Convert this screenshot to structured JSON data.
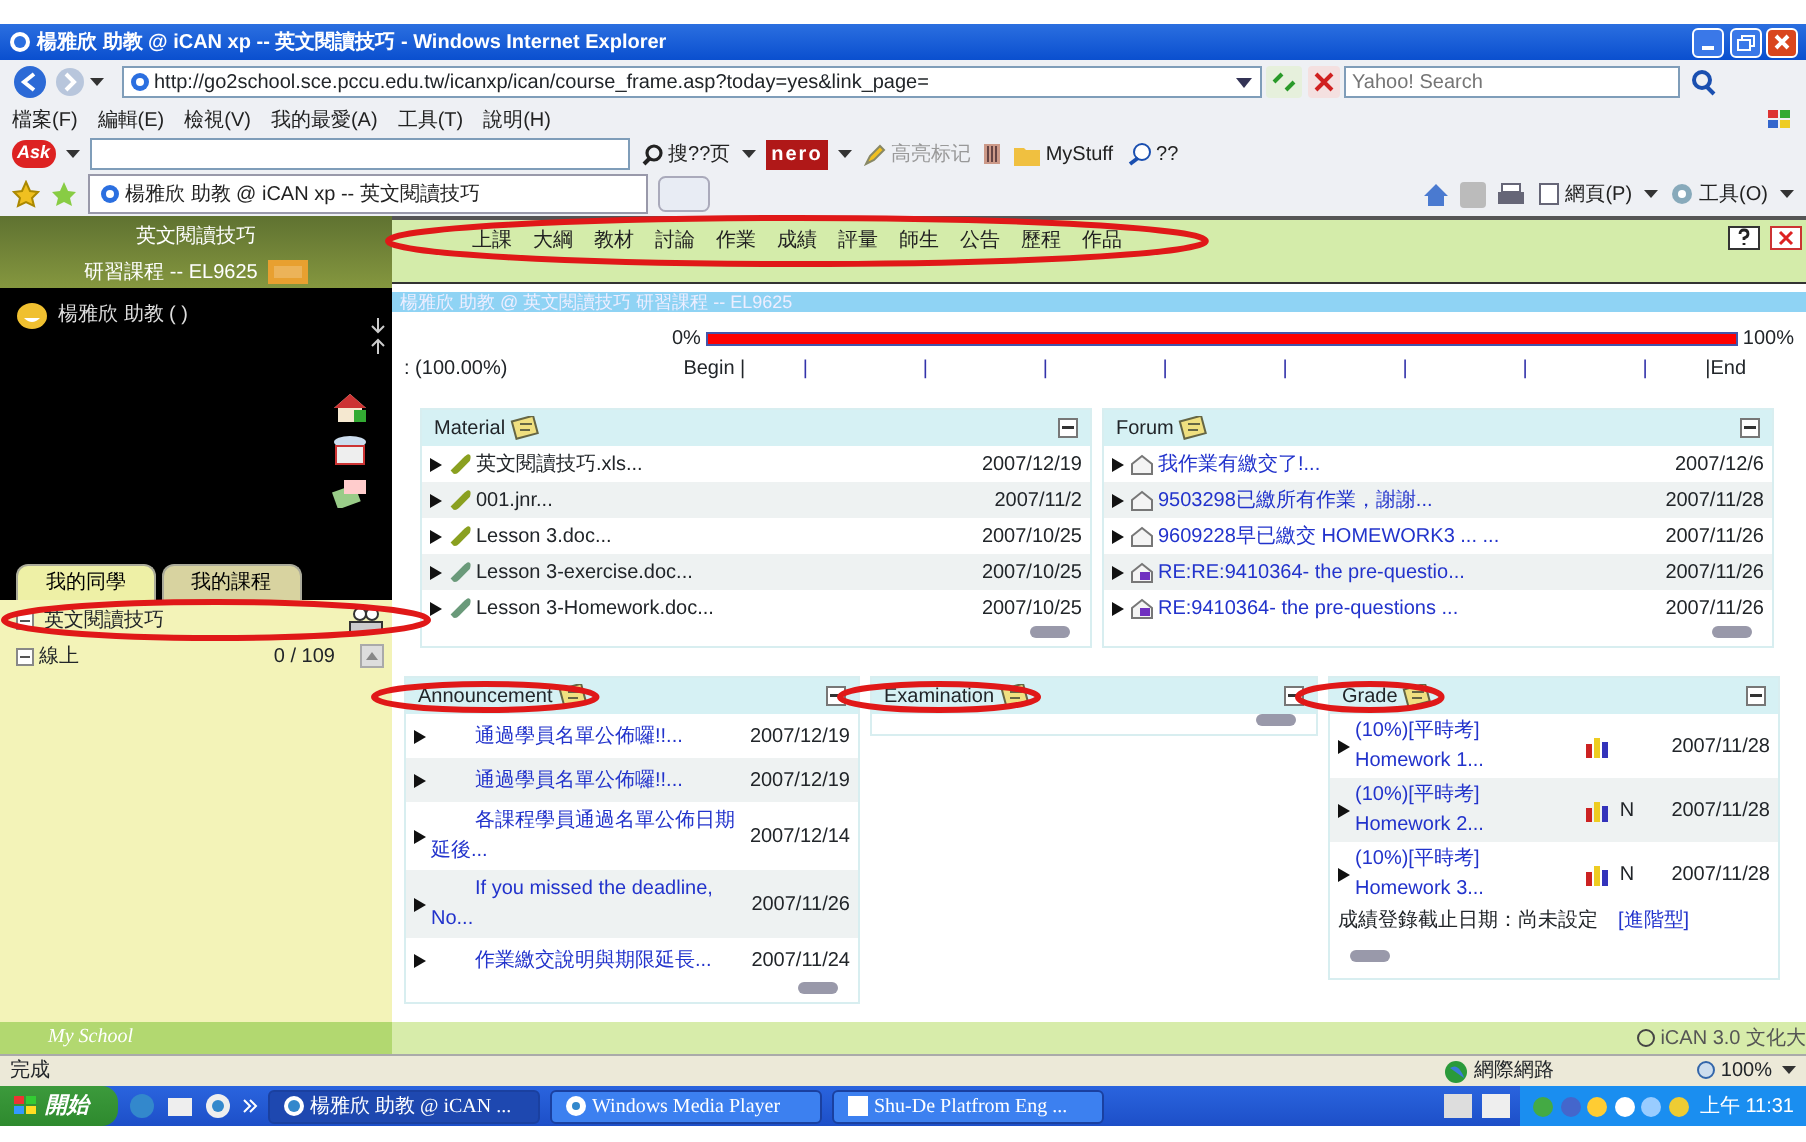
{
  "window": {
    "title": "楊雅欣 助教 @ iCAN xp -- 英文閱讀技巧 - Windows Internet Explorer"
  },
  "address_bar": {
    "url": "http://go2school.sce.pccu.edu.tw/icanxp/ican/course_frame.asp?today=yes&link_page=",
    "search_placeholder": "Yahoo! Search"
  },
  "menu_bar": [
    "檔案(F)",
    "編輯(E)",
    "檢視(V)",
    "我的最愛(A)",
    "工具(T)",
    "說明(H)"
  ],
  "ask_toolbar": {
    "logo": "Ask",
    "search_button": "搜??页",
    "nero_logo": "nero",
    "highlight_button": "高亮标记",
    "mystuff_button": "MyStuff",
    "zoom_button": "??"
  },
  "browser_tabs": [
    {
      "label": "楊雅欣 助教 @ iCAN xp -- 英文閱讀技巧",
      "selected": true
    }
  ],
  "command_bar": [
    "網頁(P)",
    "工具(O)"
  ],
  "sidebar": {
    "course": "英文閱讀技巧",
    "code": "研習課程 -- EL9625",
    "user": "楊雅欣 助教 ( )",
    "tabs": [
      {
        "label": "我的同學",
        "selected": true
      },
      {
        "label": "我的課程",
        "selected": false
      }
    ],
    "tree": {
      "label": "英文閱讀技巧",
      "expanded": true,
      "circled": true,
      "children": [
        {
          "label": "線上",
          "count": "0 / 109",
          "expanded": true
        }
      ]
    },
    "footer": "My School"
  },
  "course_menu": {
    "circled": true,
    "items": [
      "上課",
      "大綱",
      "教材",
      "討論",
      "作業",
      "成績",
      "評量",
      "師生",
      "公告",
      "歷程",
      "作品"
    ]
  },
  "breadcrumb": "楊雅欣 助教 @ 英文閱讀技巧 研習課程 -- EL9625",
  "progress": {
    "start_label": "0%",
    "end_label": "100%",
    "level": 1.0,
    "reading": ": (100.00%)",
    "begin": "Begin |",
    "ticks": [
      "|",
      "|",
      "|",
      "|",
      "|",
      "|",
      "|",
      "|"
    ],
    "end": "|End"
  },
  "panels": [
    {
      "kind": "material",
      "title": "Material",
      "circled": false,
      "items": [
        {
          "title": "英文閱讀技巧.xls...",
          "date": "2007/12/19",
          "kind": "new"
        },
        {
          "title": "001.jnr...",
          "date": "2007/11/2",
          "kind": "new"
        },
        {
          "title": "Lesson 3.doc...",
          "date": "2007/10/25",
          "kind": "new"
        },
        {
          "title": "Lesson 3-exercise.doc...",
          "date": "2007/10/25",
          "kind": "old"
        },
        {
          "title": "Lesson 3-Homework.doc...",
          "date": "2007/10/25",
          "kind": "old"
        }
      ]
    },
    {
      "kind": "forum",
      "title": "Forum",
      "circled": false,
      "items": [
        {
          "title": "我作業有繳交了!...",
          "date": "2007/12/6",
          "kind": "post"
        },
        {
          "title": "9503298已繳所有作業，謝謝...",
          "date": "2007/11/28",
          "kind": "post"
        },
        {
          "title": "9609228早已繳交 HOMEWORK3 ... ...",
          "date": "2007/11/26",
          "kind": "post"
        },
        {
          "title": "RE:RE:9410364- the pre-questio...",
          "date": "2007/11/26",
          "kind": "reply"
        },
        {
          "title": "RE:9410364- the pre-questions ...",
          "date": "2007/11/26",
          "kind": "reply"
        }
      ]
    },
    {
      "kind": "announcement",
      "title": "Announcement",
      "circled": true,
      "items": [
        {
          "title": "通過學員名單公佈囉!!...",
          "date": "2007/12/19"
        },
        {
          "title": "通過學員名單公佈囉!!...",
          "date": "2007/12/19"
        },
        {
          "title": "各課程學員通過名單公佈日期延後...",
          "date": "2007/12/14"
        },
        {
          "title": "If you missed the deadline, No...",
          "date": "2007/11/26"
        },
        {
          "title": "作業繳交說明與期限延長...",
          "date": "2007/11/24"
        }
      ]
    },
    {
      "kind": "examination",
      "title": "Examination",
      "circled": true
    },
    {
      "kind": "grade",
      "title": "Grade",
      "circled": true,
      "items": [
        {
          "title": "(10%)[平時考] Homework 1...",
          "date": "2007/11/28"
        },
        {
          "title": "(10%)[平時考] Homework 2...",
          "tag": "N",
          "date": "2007/11/28"
        },
        {
          "title": "(10%)[平時考] Homework 3...",
          "tag": "N",
          "date": "2007/11/28"
        }
      ],
      "deadline": "成績登錄截止日期：尚未設定",
      "mode_link": "[進階型]"
    }
  ],
  "footer": "iCAN 3.0 文化大",
  "status_bar": {
    "text": "完成",
    "zone": "網際網路",
    "zoom": "100%"
  },
  "taskbar": {
    "start": "開始",
    "tasks": [
      {
        "label": "楊雅欣 助教 @ iCAN ...",
        "kind": "ie",
        "selected": true
      },
      {
        "label": "Windows Media Player",
        "kind": "media",
        "selected": false
      },
      {
        "label": "Shu-De Platfrom Eng ...",
        "kind": "doc",
        "selected": false
      }
    ],
    "clock": "上午 11:31"
  }
}
